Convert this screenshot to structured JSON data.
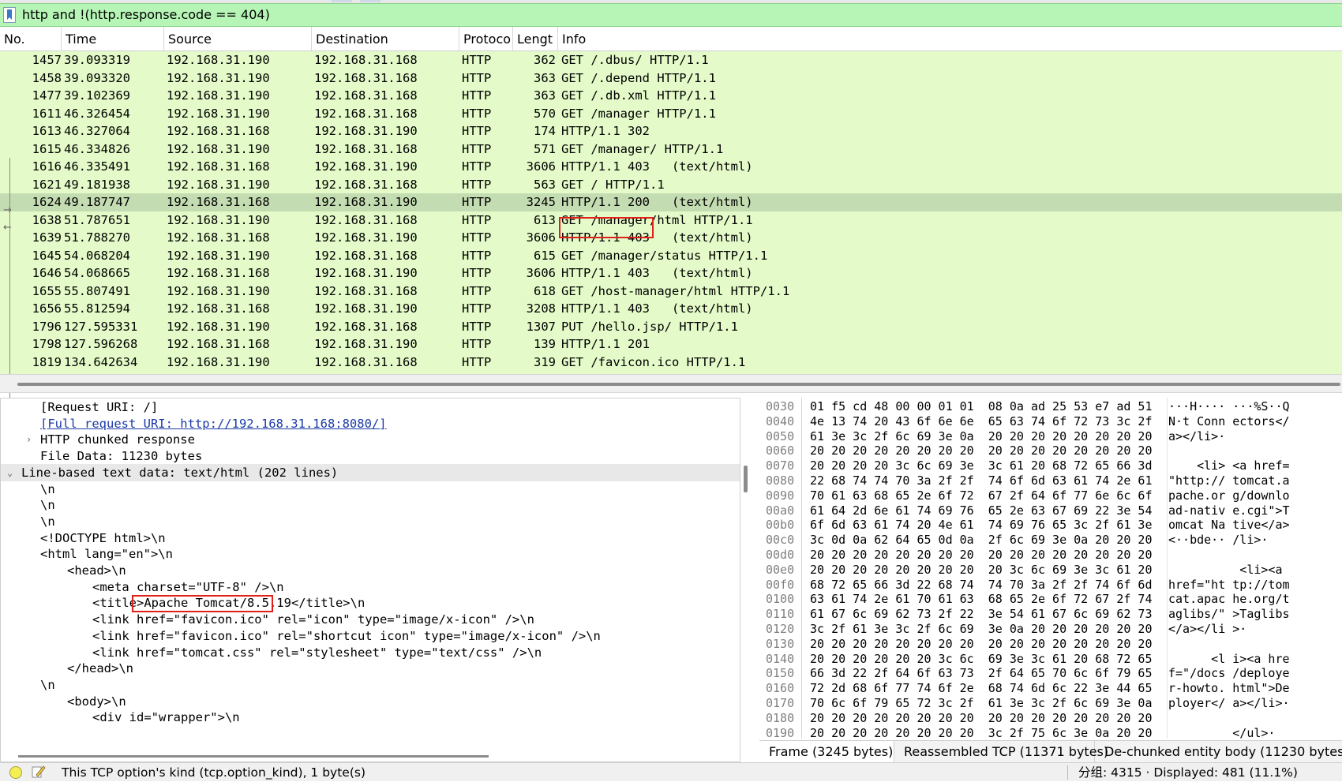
{
  "filter": {
    "text": "http and !(http.response.code == 404)"
  },
  "packet_list": {
    "columns": [
      "No.",
      "Time",
      "Source",
      "Destination",
      "Protoco",
      "Lengt",
      "Info"
    ],
    "rows": [
      {
        "no": "1457",
        "time": "39.093319",
        "src": "192.168.31.190",
        "dst": "192.168.31.168",
        "proto": "HTTP",
        "len": "362",
        "info": "GET /.dbus/ HTTP/1.1"
      },
      {
        "no": "1458",
        "time": "39.093320",
        "src": "192.168.31.190",
        "dst": "192.168.31.168",
        "proto": "HTTP",
        "len": "363",
        "info": "GET /.depend HTTP/1.1"
      },
      {
        "no": "1477",
        "time": "39.102369",
        "src": "192.168.31.190",
        "dst": "192.168.31.168",
        "proto": "HTTP",
        "len": "363",
        "info": "GET /.db.xml HTTP/1.1"
      },
      {
        "no": "1611",
        "time": "46.326454",
        "src": "192.168.31.190",
        "dst": "192.168.31.168",
        "proto": "HTTP",
        "len": "570",
        "info": "GET /manager HTTP/1.1"
      },
      {
        "no": "1613",
        "time": "46.327064",
        "src": "192.168.31.168",
        "dst": "192.168.31.190",
        "proto": "HTTP",
        "len": "174",
        "info": "HTTP/1.1 302"
      },
      {
        "no": "1615",
        "time": "46.334826",
        "src": "192.168.31.190",
        "dst": "192.168.31.168",
        "proto": "HTTP",
        "len": "571",
        "info": "GET /manager/ HTTP/1.1"
      },
      {
        "no": "1616",
        "time": "46.335491",
        "src": "192.168.31.168",
        "dst": "192.168.31.190",
        "proto": "HTTP",
        "len": "3606",
        "info": "HTTP/1.1 403   (text/html)"
      },
      {
        "no": "1621",
        "time": "49.181938",
        "src": "192.168.31.190",
        "dst": "192.168.31.168",
        "proto": "HTTP",
        "len": "563",
        "info": "GET / HTTP/1.1"
      },
      {
        "no": "1624",
        "time": "49.187747",
        "src": "192.168.31.168",
        "dst": "192.168.31.190",
        "proto": "HTTP",
        "len": "3245",
        "info": "HTTP/1.1 200   (text/html)"
      },
      {
        "no": "1638",
        "time": "51.787651",
        "src": "192.168.31.190",
        "dst": "192.168.31.168",
        "proto": "HTTP",
        "len": "613",
        "info": "GET /manager/html HTTP/1.1"
      },
      {
        "no": "1639",
        "time": "51.788270",
        "src": "192.168.31.168",
        "dst": "192.168.31.190",
        "proto": "HTTP",
        "len": "3606",
        "info": "HTTP/1.1 403   (text/html)"
      },
      {
        "no": "1645",
        "time": "54.068204",
        "src": "192.168.31.190",
        "dst": "192.168.31.168",
        "proto": "HTTP",
        "len": "615",
        "info": "GET /manager/status HTTP/1.1"
      },
      {
        "no": "1646",
        "time": "54.068665",
        "src": "192.168.31.168",
        "dst": "192.168.31.190",
        "proto": "HTTP",
        "len": "3606",
        "info": "HTTP/1.1 403   (text/html)"
      },
      {
        "no": "1655",
        "time": "55.807491",
        "src": "192.168.31.190",
        "dst": "192.168.31.168",
        "proto": "HTTP",
        "len": "618",
        "info": "GET /host-manager/html HTTP/1.1"
      },
      {
        "no": "1656",
        "time": "55.812594",
        "src": "192.168.31.168",
        "dst": "192.168.31.190",
        "proto": "HTTP",
        "len": "3208",
        "info": "HTTP/1.1 403   (text/html)"
      },
      {
        "no": "1796",
        "time": "127.595331",
        "src": "192.168.31.190",
        "dst": "192.168.31.168",
        "proto": "HTTP",
        "len": "1307",
        "info": "PUT /hello.jsp/ HTTP/1.1"
      },
      {
        "no": "1798",
        "time": "127.596268",
        "src": "192.168.31.168",
        "dst": "192.168.31.190",
        "proto": "HTTP",
        "len": "139",
        "info": "HTTP/1.1 201"
      },
      {
        "no": "1819",
        "time": "134.642634",
        "src": "192.168.31.190",
        "dst": "192.168.31.168",
        "proto": "HTTP",
        "len": "319",
        "info": "GET /favicon.ico HTTP/1.1"
      }
    ],
    "selected_row_no": "1624",
    "colors": {
      "row_bg": "#e4fbc9",
      "selected_bg": "#c4dcb1",
      "highlight": "#e0201a"
    }
  },
  "detail": {
    "lines": [
      {
        "text": "[Request URI: /]"
      },
      {
        "text": "[Full request URI: http://192.168.31.168:8080/]"
      },
      {
        "text": "HTTP chunked response"
      },
      {
        "text": "File Data: 11230 bytes"
      },
      {
        "text": "Line-based text data: text/html (202 lines)"
      },
      {
        "text": "\\n"
      },
      {
        "text": "\\n"
      },
      {
        "text": "\\n"
      },
      {
        "text": "<!DOCTYPE html>\\n"
      },
      {
        "text": "<html lang=\"en\">\\n"
      },
      {
        "text": "<head>\\n"
      },
      {
        "text": "<meta charset=\"UTF-8\" />\\n"
      },
      {
        "text": "<title>Apache Tomcat/8.5.19</title>\\n"
      },
      {
        "text": "<link href=\"favicon.ico\" rel=\"icon\" type=\"image/x-icon\" />\\n"
      },
      {
        "text": "<link href=\"favicon.ico\" rel=\"shortcut icon\" type=\"image/x-icon\" />\\n"
      },
      {
        "text": "<link href=\"tomcat.css\" rel=\"stylesheet\" type=\"text/css\" />\\n"
      },
      {
        "text": "</head>\\n"
      },
      {
        "text": "\\n"
      },
      {
        "text": "<body>\\n"
      },
      {
        "text": "<div id=\"wrapper\">\\n"
      }
    ]
  },
  "bytes": {
    "rows": [
      {
        "offset": "0030",
        "hex": "01 f5 cd 48 00 00 01 01  08 0a ad 25 53 e7 ad 51",
        "ascii": "···H···· ···%S··Q"
      },
      {
        "offset": "0040",
        "hex": "4e 13 74 20 43 6f 6e 6e  65 63 74 6f 72 73 3c 2f",
        "ascii": "N·t Conn ectors</"
      },
      {
        "offset": "0050",
        "hex": "61 3e 3c 2f 6c 69 3e 0a  20 20 20 20 20 20 20 20",
        "ascii": "a></li>·         "
      },
      {
        "offset": "0060",
        "hex": "20 20 20 20 20 20 20 20  20 20 20 20 20 20 20 20",
        "ascii": "                 "
      },
      {
        "offset": "0070",
        "hex": "20 20 20 20 3c 6c 69 3e  3c 61 20 68 72 65 66 3d",
        "ascii": "    <li> <a href="
      },
      {
        "offset": "0080",
        "hex": "22 68 74 74 70 3a 2f 2f  74 6f 6d 63 61 74 2e 61",
        "ascii": "\"http:// tomcat.a"
      },
      {
        "offset": "0090",
        "hex": "70 61 63 68 65 2e 6f 72  67 2f 64 6f 77 6e 6c 6f",
        "ascii": "pache.or g/downlo"
      },
      {
        "offset": "00a0",
        "hex": "61 64 2d 6e 61 74 69 76  65 2e 63 67 69 22 3e 54",
        "ascii": "ad-nativ e.cgi\">T"
      },
      {
        "offset": "00b0",
        "hex": "6f 6d 63 61 74 20 4e 61  74 69 76 65 3c 2f 61 3e",
        "ascii": "omcat Na tive</a>"
      },
      {
        "offset": "00c0",
        "hex": "3c 0d 0a 62 64 65 0d 0a  2f 6c 69 3e 0a 20 20 20",
        "ascii": "<··bde·· /li>·   "
      },
      {
        "offset": "00d0",
        "hex": "20 20 20 20 20 20 20 20  20 20 20 20 20 20 20 20",
        "ascii": "                 "
      },
      {
        "offset": "00e0",
        "hex": "20 20 20 20 20 20 20 20  20 3c 6c 69 3e 3c 61 20",
        "ascii": "          <li><a "
      },
      {
        "offset": "00f0",
        "hex": "68 72 65 66 3d 22 68 74  74 70 3a 2f 2f 74 6f 6d",
        "ascii": "href=\"ht tp://tom"
      },
      {
        "offset": "0100",
        "hex": "63 61 74 2e 61 70 61 63  68 65 2e 6f 72 67 2f 74",
        "ascii": "cat.apac he.org/t"
      },
      {
        "offset": "0110",
        "hex": "61 67 6c 69 62 73 2f 22  3e 54 61 67 6c 69 62 73",
        "ascii": "aglibs/\" >Taglibs"
      },
      {
        "offset": "0120",
        "hex": "3c 2f 61 3e 3c 2f 6c 69  3e 0a 20 20 20 20 20 20",
        "ascii": "</a></li >·      "
      },
      {
        "offset": "0130",
        "hex": "20 20 20 20 20 20 20 20  20 20 20 20 20 20 20 20",
        "ascii": "                 "
      },
      {
        "offset": "0140",
        "hex": "20 20 20 20 20 20 3c 6c  69 3e 3c 61 20 68 72 65",
        "ascii": "      <l i><a hre"
      },
      {
        "offset": "0150",
        "hex": "66 3d 22 2f 64 6f 63 73  2f 64 65 70 6c 6f 79 65",
        "ascii": "f=\"/docs /deploye"
      },
      {
        "offset": "0160",
        "hex": "72 2d 68 6f 77 74 6f 2e  68 74 6d 6c 22 3e 44 65",
        "ascii": "r-howto. html\">De"
      },
      {
        "offset": "0170",
        "hex": "70 6c 6f 79 65 72 3c 2f  61 3e 3c 2f 6c 69 3e 0a",
        "ascii": "ployer</ a></li>·"
      },
      {
        "offset": "0180",
        "hex": "20 20 20 20 20 20 20 20  20 20 20 20 20 20 20 20",
        "ascii": "                 "
      },
      {
        "offset": "0190",
        "hex": "20 20 20 20 20 20 20 20  3c 2f 75 6c 3e 0a 20 20",
        "ascii": "         </ul>·  "
      }
    ],
    "tabs": [
      "Frame (3245 bytes)",
      "Reassembled TCP (11371 bytes)",
      "De-chunked entity body (11230 bytes)"
    ]
  },
  "status": {
    "text": "This TCP option's kind (tcp.option_kind), 1 byte(s)",
    "stats": "分组: 4315 · Displayed: 481 (11.1%)"
  },
  "icons": {
    "bookmark": "bookmark-icon",
    "led": "status-led-icon",
    "edit": "edit-comment-icon"
  }
}
